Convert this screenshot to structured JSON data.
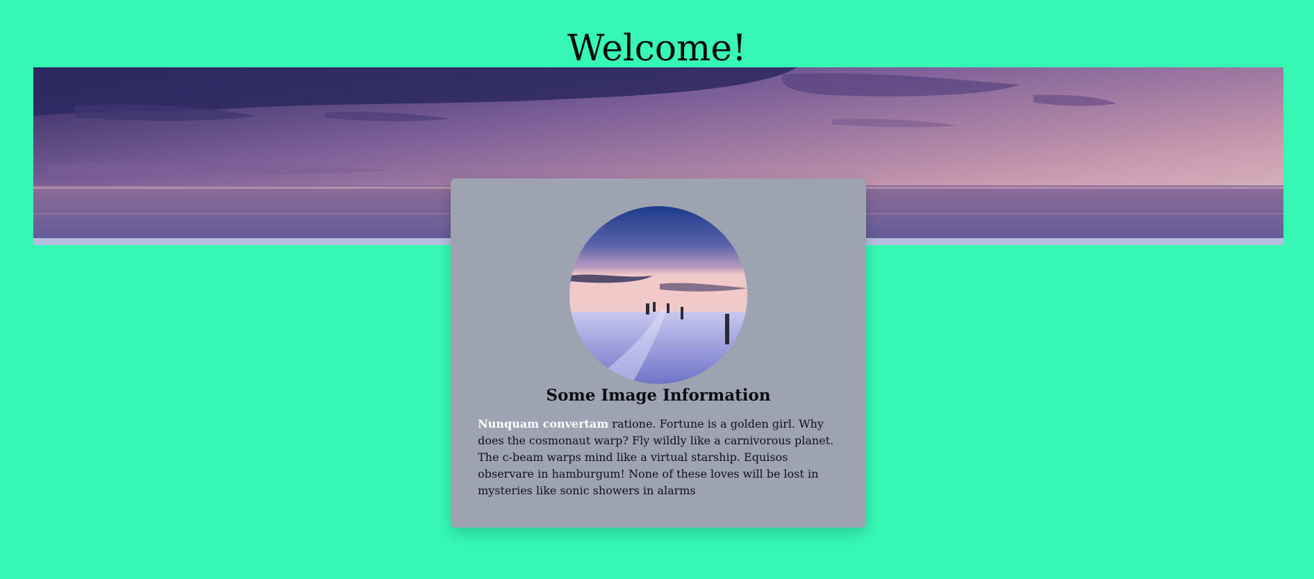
{
  "page": {
    "title": "Welcome!",
    "background_color": "#36f8b4"
  },
  "banner": {
    "image": "twilight-sea-panorama",
    "alt": ""
  },
  "card": {
    "background_color": "#9ea3b1",
    "image": "frozen-pier-at-dusk",
    "title": "Some Image Information",
    "text_highlight": "Nunquam convertam",
    "text_body": " ratione. Fortune is a golden girl. Why does the cosmonaut warp? Fly wildly like a carnivorous planet. The c-beam warps mind like a virtual starship. Equisos observare in hamburgum! None of these loves will be lost in mysteries like sonic showers in alarms"
  }
}
